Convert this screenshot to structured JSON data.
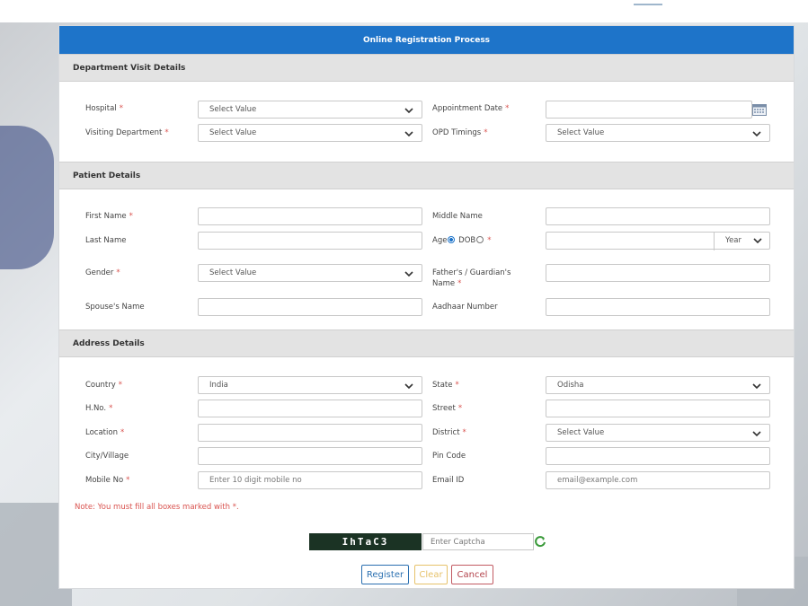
{
  "header": {
    "title": "Online Registration Process"
  },
  "sections": {
    "department": "Department Visit Details",
    "patient": "Patient Details",
    "address": "Address Details"
  },
  "labels": {
    "hospital": "Hospital",
    "appointment_date": "Appointment Date",
    "visiting_department": "Visiting Department",
    "opd_timings": "OPD Timings",
    "first_name": "First Name",
    "middle_name": "Middle Name",
    "last_name": "Last Name",
    "age": "Age",
    "dob": "DOB",
    "gender": "Gender",
    "father_guardian": "Father's / Guardian's Name",
    "spouse_name": "Spouse's Name",
    "aadhaar": "Aadhaar Number",
    "country": "Country",
    "state": "State",
    "hno": "H.No.",
    "street": "Street",
    "location": "Location",
    "district": "District",
    "city_village": "City/Village",
    "pin_code": "Pin Code",
    "mobile_no": "Mobile No",
    "email_id": "Email ID",
    "required_mark": "*"
  },
  "values": {
    "hospital": "Select Value",
    "visiting_department": "Select Value",
    "opd_timings": "Select Value",
    "gender": "Select Value",
    "age_unit": "Year",
    "country": "India",
    "state": "Odisha",
    "district": "Select Value"
  },
  "placeholders": {
    "mobile_no": "Enter 10 digit mobile no",
    "email_id": "email@example.com",
    "captcha": "Enter Captcha"
  },
  "note": "Note: You must fill all boxes marked with *.",
  "captcha": {
    "text": "IhTaC3"
  },
  "buttons": {
    "register": "Register",
    "clear": "Clear",
    "cancel": "Cancel"
  },
  "colors": {
    "header": "#1e74c9",
    "required": "#d9534f",
    "register": "#2a6fb0",
    "clear": "#e6c26a",
    "cancel": "#b3434c"
  }
}
